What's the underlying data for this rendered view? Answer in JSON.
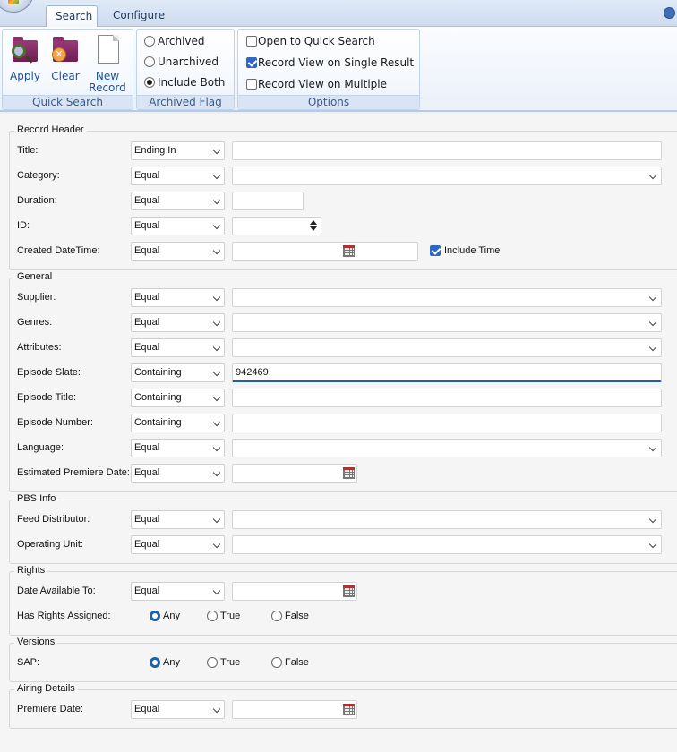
{
  "ribbon": {
    "tabs": [
      {
        "label": "Search",
        "active": true
      },
      {
        "label": "Configure",
        "active": false
      }
    ],
    "quick_search": {
      "label": "Quick Search",
      "apply": "Apply",
      "clear": "Clear",
      "new_record_line1": "New",
      "new_record_line2": "Record"
    },
    "archived_flag": {
      "label": "Archived Flag",
      "options": [
        "Archived",
        "Unarchived",
        "Include Both"
      ],
      "selected": "Include Both"
    },
    "options": {
      "label": "Options",
      "items": [
        {
          "label": "Open to Quick Search",
          "checked": false
        },
        {
          "label": "Record View on Single Result",
          "checked": true
        },
        {
          "label": "Record View on Multiple",
          "checked": false
        }
      ]
    }
  },
  "sections": {
    "record_header": {
      "title": "Record Header",
      "title_label": "Title:",
      "title_op": "Ending In",
      "category_label": "Category:",
      "category_op": "Equal",
      "duration_label": "Duration:",
      "duration_op": "Equal",
      "id_label": "ID:",
      "id_op": "Equal",
      "created_label": "Created DateTime:",
      "created_op": "Equal",
      "include_time": "Include Time"
    },
    "general": {
      "title": "General",
      "supplier_label": "Supplier:",
      "supplier_op": "Equal",
      "genres_label": "Genres:",
      "genres_op": "Equal",
      "attributes_label": "Attributes:",
      "attributes_op": "Equal",
      "episode_slate_label": "Episode Slate:",
      "episode_slate_op": "Containing",
      "episode_slate_value": "942469",
      "episode_title_label": "Episode Title:",
      "episode_title_op": "Containing",
      "episode_number_label": "Episode Number:",
      "episode_number_op": "Containing",
      "language_label": "Language:",
      "language_op": "Equal",
      "premiere_label": "Estimated Premiere Date:",
      "premiere_op": "Equal"
    },
    "pbs_info": {
      "title": "PBS Info",
      "feed_label": "Feed Distributor:",
      "feed_op": "Equal",
      "unit_label": "Operating Unit:",
      "unit_op": "Equal"
    },
    "rights": {
      "title": "Rights",
      "date_label": "Date Available To:",
      "date_op": "Equal",
      "assigned_label": "Has Rights Assigned:",
      "opt_any": "Any",
      "opt_true": "True",
      "opt_false": "False"
    },
    "versions": {
      "title": "Versions",
      "sap_label": "SAP:",
      "opt_any": "Any",
      "opt_true": "True",
      "opt_false": "False"
    },
    "airing": {
      "title": "Airing Details",
      "premiere_label": "Premiere Date:",
      "premiere_op": "Equal"
    }
  },
  "colors": {
    "accent": "#1f5fa8",
    "ribbon_label": "#3b5b86"
  }
}
